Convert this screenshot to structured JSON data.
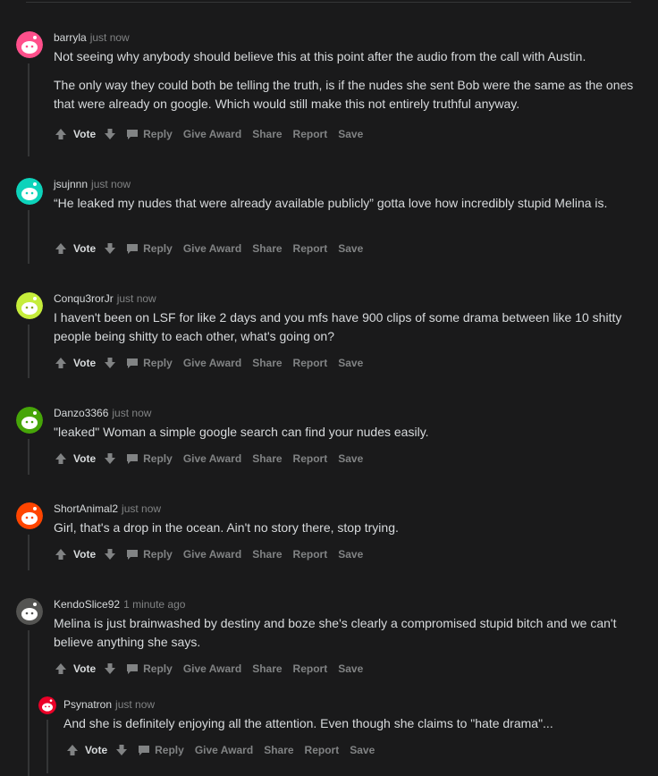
{
  "actions": {
    "vote": "Vote",
    "reply": "Reply",
    "give_award": "Give Award",
    "share": "Share",
    "report": "Report",
    "save": "Save"
  },
  "comments": [
    {
      "author": "barryla",
      "time": "just now",
      "avatar_color": "#ff4f8b",
      "paragraphs": [
        "Not seeing why anybody should believe this at this point after the audio from the call with Austin.",
        "The only way they could both be telling the truth, is if the nudes she sent Bob were the same as the ones that were already on google. Which would still make this not entirely truthful anyway."
      ]
    },
    {
      "author": "jsujnnn",
      "time": "just now",
      "avatar_color": "#0dd3bb",
      "paragraphs": [
        "“He leaked my nudes that were already available publicly” gotta love how incredibly stupid Melina is."
      ]
    },
    {
      "author": "Conqu3rorJr",
      "time": "just now",
      "avatar_color": "#c6ed3b",
      "paragraphs": [
        "I haven't been on LSF for like 2 days and you mfs have 900 clips of some drama between like 10 shitty people being shitty to each other, what's going on?"
      ]
    },
    {
      "author": "Danzo3366",
      "time": "just now",
      "avatar_color": "#46a508",
      "paragraphs": [
        "\"leaked\" Woman a simple google search can find your nudes easily."
      ]
    },
    {
      "author": "ShortAnimal2",
      "time": "just now",
      "avatar_color": "#ff4500",
      "paragraphs": [
        "Girl, that's a drop in the ocean. Ain't no story there, stop trying."
      ]
    },
    {
      "author": "KendoSlice92",
      "time": "1 minute ago",
      "avatar_color": "#545452",
      "paragraphs": [
        "Melina is just brainwashed by destiny and boze she's clearly a compromised stupid bitch and we can't believe anything she says."
      ]
    },
    {
      "author": "Psynatron",
      "time": "just now",
      "avatar_color": "#ea0027",
      "paragraphs": [
        "And she is definitely enjoying all the attention. Even though she claims to \"hate drama\"..."
      ]
    }
  ]
}
